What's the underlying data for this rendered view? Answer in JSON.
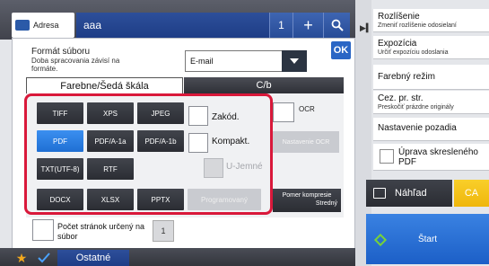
{
  "topbar": {
    "address_label": "Adresa",
    "address_value": "aaa",
    "count": "1",
    "plus": "+",
    "search_icon": "search-icon"
  },
  "settings": {
    "file_format_label": "Formát súboru",
    "file_format_sub": "Doba spracovania závisí na formáte.",
    "mode_value": "E-mail",
    "ok_label": "OK"
  },
  "tabs": [
    {
      "label": "Farebne/Šedá škála",
      "selected": true
    },
    {
      "label": "C/b",
      "selected": false
    }
  ],
  "formats": {
    "tiff": "TIFF",
    "xps": "XPS",
    "jpeg": "JPEG",
    "pdf": "PDF",
    "pdfa1a": "PDF/A-1a",
    "pdfa1b": "PDF/A-1b",
    "txt": "TXT(UTF-8)",
    "rtf": "RTF",
    "docx": "DOCX",
    "xlsx": "XLSX",
    "pptx": "PPTX",
    "selected": "PDF"
  },
  "options": {
    "encrypt": "Zakód.",
    "compact": "Kompakt.",
    "ufine": "U-Jemné",
    "ocr": "OCR",
    "ocr_settings": "Nastavenie OCR",
    "programmed": "Programovaný",
    "ratio_title": "Pomer kompresie",
    "ratio_value": "Stredný"
  },
  "pages": {
    "label": "Počet stránok určený na súbor",
    "count": "1"
  },
  "bottombar": {
    "other_label": "Ostatné"
  },
  "right_panel": {
    "items": [
      {
        "title": "Rozlíšenie",
        "sub": "Zmeniť rozlíšenie odosielaní"
      },
      {
        "title": "Expozícia",
        "sub": "Určiť expozíciu odoslania"
      },
      {
        "title": "Farebný režim",
        "sub": ""
      },
      {
        "title": "Cez. pr. str.",
        "sub": "Preskočiť prázdne originály"
      },
      {
        "title": "Nastavenie pozadia",
        "sub": ""
      }
    ],
    "skew_label": "Úprava skresleného PDF",
    "preview_label": "Náhľad",
    "ca_label": "CA",
    "start_label": "Štart"
  }
}
